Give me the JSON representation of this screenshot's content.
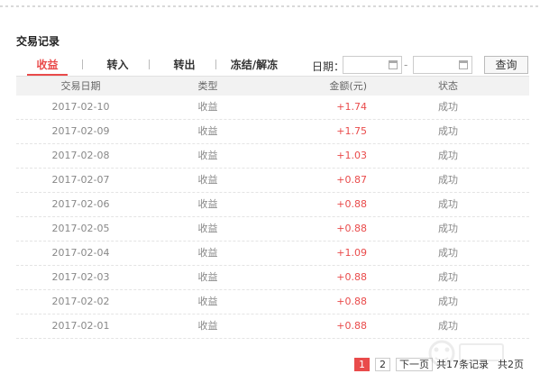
{
  "section_title": "交易记录",
  "tabs": [
    {
      "label": "收益",
      "active": true
    },
    {
      "label": "转入",
      "active": false
    },
    {
      "label": "转出",
      "active": false
    },
    {
      "label": "冻结/解冻",
      "active": false
    }
  ],
  "date_filter": {
    "label": "日期：",
    "separator": "-",
    "start_value": "",
    "end_value": "",
    "query_label": "查询"
  },
  "table": {
    "headers": [
      "交易日期",
      "类型",
      "金额(元)",
      "状态"
    ],
    "rows": [
      {
        "date": "2017-02-10",
        "type": "收益",
        "amount": "+1.74",
        "status": "成功"
      },
      {
        "date": "2017-02-09",
        "type": "收益",
        "amount": "+1.75",
        "status": "成功"
      },
      {
        "date": "2017-02-08",
        "type": "收益",
        "amount": "+1.03",
        "status": "成功"
      },
      {
        "date": "2017-02-07",
        "type": "收益",
        "amount": "+0.87",
        "status": "成功"
      },
      {
        "date": "2017-02-06",
        "type": "收益",
        "amount": "+0.88",
        "status": "成功"
      },
      {
        "date": "2017-02-05",
        "type": "收益",
        "amount": "+0.88",
        "status": "成功"
      },
      {
        "date": "2017-02-04",
        "type": "收益",
        "amount": "+1.09",
        "status": "成功"
      },
      {
        "date": "2017-02-03",
        "type": "收益",
        "amount": "+0.88",
        "status": "成功"
      },
      {
        "date": "2017-02-02",
        "type": "收益",
        "amount": "+0.88",
        "status": "成功"
      },
      {
        "date": "2017-02-01",
        "type": "收益",
        "amount": "+0.88",
        "status": "成功"
      }
    ]
  },
  "pagination": {
    "pages": [
      "1",
      "2"
    ],
    "current": "1",
    "next_label": "下一页",
    "total_records": "共17条记录",
    "total_pages": "共2页"
  },
  "colors": {
    "accent": "#e94b4b",
    "header_bg": "#f2f2f2"
  }
}
